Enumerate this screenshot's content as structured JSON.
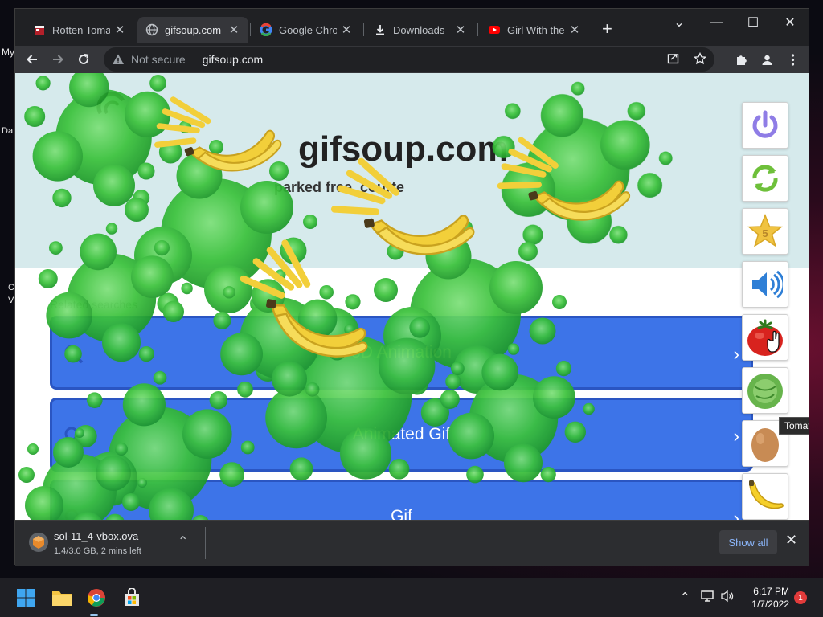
{
  "desktop": {
    "fragments": [
      "My",
      "Da",
      "C",
      "V"
    ]
  },
  "browser": {
    "tabs": [
      {
        "title": "Rotten Tomato",
        "icon": "rotten-tomatoes-favicon",
        "active": false
      },
      {
        "title": "gifsoup.com",
        "icon": "globe-icon",
        "active": true
      },
      {
        "title": "Google Chrom",
        "icon": "google-favicon",
        "active": false
      },
      {
        "title": "Downloads",
        "icon": "download-icon",
        "active": false
      },
      {
        "title": "Girl With the n",
        "icon": "youtube-favicon",
        "active": false
      }
    ],
    "new_tab": "+",
    "window_controls": {
      "list": "⌄",
      "minimize": "—",
      "maximize": "☐",
      "close": "✕"
    },
    "omnibox": {
      "security_label": "Not secure",
      "url": "gifsoup.com"
    }
  },
  "page": {
    "site_title": "gifsoup.com",
    "site_subtitle": "parked free, courte",
    "related_label": "Related searches",
    "related_buttons": [
      {
        "label": "3D Animation"
      },
      {
        "label": "Animated Gif"
      },
      {
        "label": "Gif"
      }
    ]
  },
  "extension_panel": {
    "buttons": [
      {
        "name": "power",
        "icon": "power-icon"
      },
      {
        "name": "refresh",
        "icon": "refresh-icon"
      },
      {
        "name": "star",
        "icon": "star-icon",
        "badge": "5"
      },
      {
        "name": "sound",
        "icon": "speaker-icon"
      },
      {
        "name": "tomato",
        "icon": "tomato-icon"
      },
      {
        "name": "cabbage",
        "icon": "cabbage-icon"
      },
      {
        "name": "egg",
        "icon": "egg-icon"
      },
      {
        "name": "banana",
        "icon": "banana-icon"
      }
    ],
    "tooltip": "Tomato"
  },
  "download_shelf": {
    "file_name": "sol-11_4-vbox.ova",
    "status": "1.4/3.0 GB, 2 mins left",
    "show_all": "Show all"
  },
  "taskbar": {
    "time": "6:17 PM",
    "date": "1/7/2022",
    "notification_count": "1"
  },
  "colors": {
    "chrome_dark": "#202124",
    "toolbar": "#35363a",
    "hero_bg": "#d6eaec",
    "related_blue": "#3d74e8",
    "slime_green": "#3cc23c",
    "banana_yellow": "#f2cf3a"
  }
}
